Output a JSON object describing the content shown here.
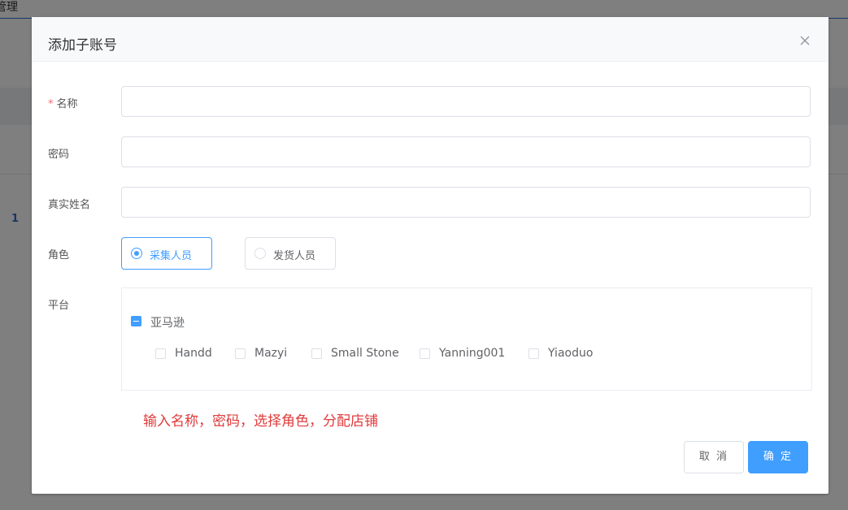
{
  "background": {
    "title": "管理",
    "row_number": "1"
  },
  "dialog": {
    "title": "添加子账号",
    "close_icon": "close-icon"
  },
  "form": {
    "name": {
      "required_mark": "*",
      "label": "名称",
      "value": ""
    },
    "password": {
      "label": "密码",
      "value": ""
    },
    "real_name": {
      "label": "真实姓名",
      "value": ""
    },
    "role": {
      "label": "角色",
      "options": [
        {
          "label": "采集人员",
          "checked": true
        },
        {
          "label": "发货人员",
          "checked": false
        }
      ]
    },
    "platform": {
      "label": "平台",
      "parent": {
        "label": "亚马逊",
        "state": "indeterminate"
      },
      "stores": [
        {
          "label": "Handd",
          "checked": false
        },
        {
          "label": "Mazyi",
          "checked": false
        },
        {
          "label": "Small Stone",
          "checked": false
        },
        {
          "label": "Yanning001",
          "checked": false
        },
        {
          "label": "Yiaoduo",
          "checked": false
        }
      ]
    }
  },
  "annotation": "输入名称，密码，选择角色，分配店铺",
  "footer": {
    "cancel_label": "取 消",
    "confirm_label": "确 定"
  },
  "colors": {
    "primary": "#409eff",
    "annotation_red": "#e03a3a",
    "required": "#f56c6c"
  }
}
